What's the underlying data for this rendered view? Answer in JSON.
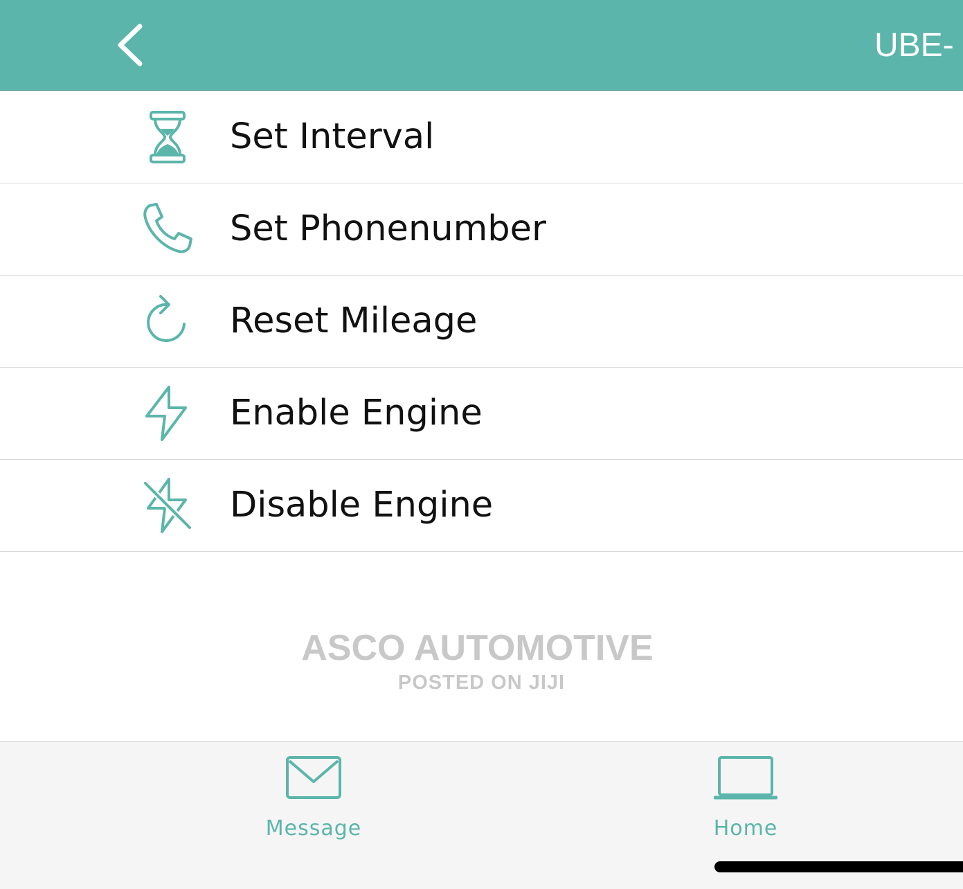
{
  "colors": {
    "accent": "#5bb5aa",
    "header_text": "#ffffff",
    "watermark": "#c8c8c8"
  },
  "header": {
    "title": "UBE-",
    "back_icon": "chevron-left-icon"
  },
  "menu": {
    "items": [
      {
        "label": "Set Interval",
        "icon": "hourglass-icon"
      },
      {
        "label": "Set Phonenumber",
        "icon": "phone-icon"
      },
      {
        "label": "Reset Mileage",
        "icon": "refresh-icon"
      },
      {
        "label": "Enable Engine",
        "icon": "lightning-bolt-icon"
      },
      {
        "label": "Disable Engine",
        "icon": "lightning-bolt-off-icon"
      }
    ]
  },
  "watermark": {
    "main": "ASCO AUTOMOTIVE",
    "sub": "POSTED ON JIJI"
  },
  "tabbar": {
    "tabs": [
      {
        "label": "Message",
        "icon": "envelope-icon"
      },
      {
        "label": "Home",
        "icon": "laptop-icon"
      }
    ]
  }
}
